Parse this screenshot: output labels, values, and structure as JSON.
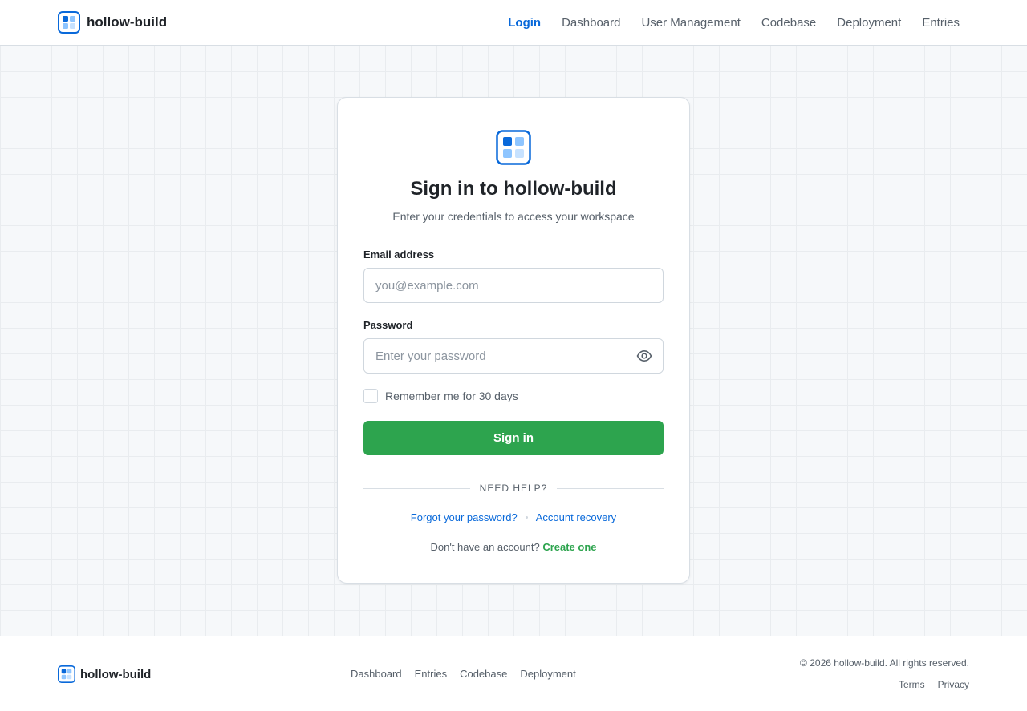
{
  "colors": {
    "accent": "#0969da",
    "success": "#2da44e",
    "logo_dark": "#0969da",
    "logo_light": "#8ec5ff"
  },
  "header": {
    "brand": "hollow-build",
    "logo_icon": "grid-logo-icon",
    "nav": [
      {
        "label": "Login",
        "active": true
      },
      {
        "label": "Dashboard"
      },
      {
        "label": "User Management"
      },
      {
        "label": "Codebase"
      },
      {
        "label": "Deployment"
      },
      {
        "label": "Entries"
      }
    ]
  },
  "login": {
    "title": "Sign in to hollow-build",
    "subtitle": "Enter your credentials to access your workspace",
    "email_label": "Email address",
    "email_placeholder": "you@example.com",
    "email_value": "",
    "password_label": "Password",
    "password_placeholder": "Enter your password",
    "password_value": "",
    "show_password_icon": "eye-icon",
    "remember_label": "Remember me for 30 days",
    "remember_checked": false,
    "submit_label": "Sign in",
    "help_heading": "NEED HELP?",
    "forgot_label": "Forgot your password?",
    "recovery_label": "Account recovery",
    "signup_prompt": "Don't have an account?",
    "signup_link": "Create one"
  },
  "footer": {
    "brand": "hollow-build",
    "nav": [
      "Dashboard",
      "Entries",
      "Codebase",
      "Deployment"
    ],
    "copyright": "© 2026 hollow-build. All rights reserved.",
    "legal": [
      "Terms",
      "Privacy"
    ]
  }
}
